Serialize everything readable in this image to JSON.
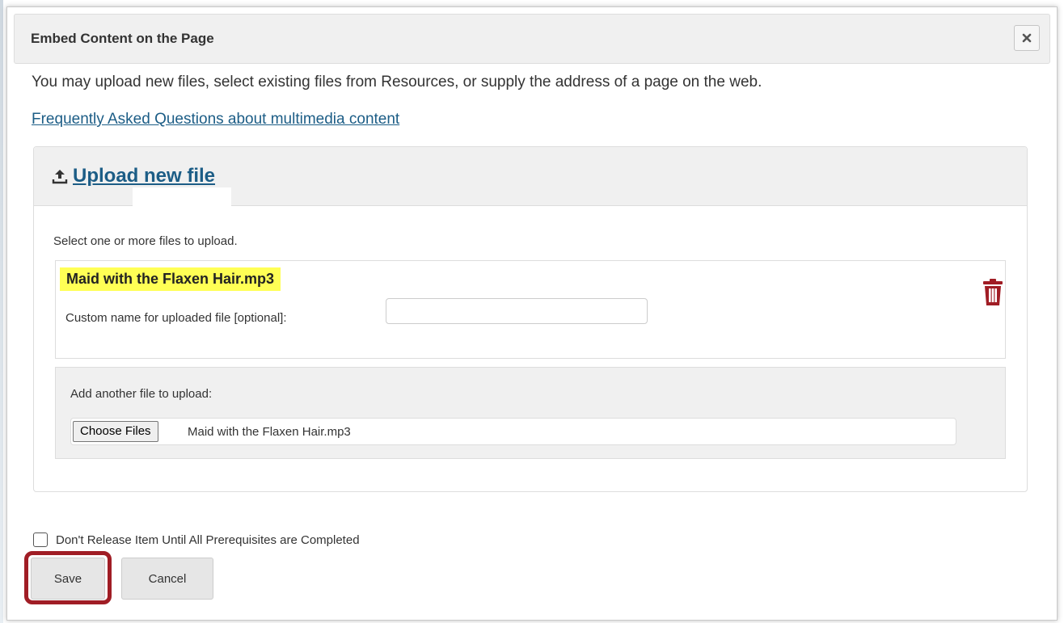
{
  "dialog": {
    "title": "Embed Content on the Page",
    "close_icon": "close-icon"
  },
  "intro": {
    "text": "You may upload new files, select existing files from Resources, or supply the address of a page on the web.",
    "faq_link": "Frequently Asked Questions about multimedia content"
  },
  "upload": {
    "header_label": "Upload new file",
    "header_icon": "upload-icon",
    "select_hint": "Select one or more files to upload.",
    "file": {
      "name": "Maid with the Flaxen Hair.mp3",
      "custom_name_label": "Custom name for uploaded file [optional]:",
      "custom_name_value": "",
      "delete_icon": "trash-icon"
    },
    "add_another": {
      "label": "Add another file to upload:",
      "choose_button": "Choose Files",
      "chosen_file": "Maid with the Flaxen Hair.mp3"
    }
  },
  "prerequisite": {
    "label": "Don't Release Item Until All Prerequisites are Completed",
    "checked": false
  },
  "actions": {
    "save": "Save",
    "cancel": "Cancel"
  },
  "colors": {
    "link": "#1c5d86",
    "highlight": "#ffff55",
    "delete": "#a01d25",
    "save_outline": "#a01d25"
  }
}
